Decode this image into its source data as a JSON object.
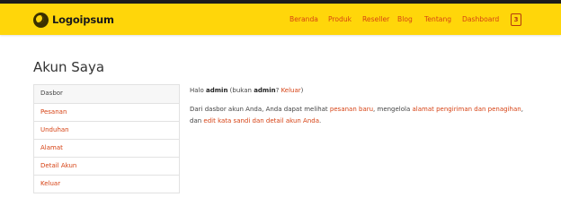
{
  "header": {
    "logo_text": "Logoipsum",
    "nav": [
      "Beranda",
      "Produk",
      "Reseller",
      "Blog",
      "Tentang",
      "Dashboard"
    ],
    "cart_count": "3",
    "colors": {
      "bar": "#ffd60a",
      "link": "#d64214",
      "top_strip": "#1c1c1c"
    }
  },
  "page": {
    "title": "Akun Saya"
  },
  "sidebar": {
    "items": [
      "Dasbor",
      "Pesanan",
      "Unduhan",
      "Alamat",
      "Detail Akun",
      "Keluar"
    ]
  },
  "content": {
    "greeting": {
      "hello": "Halo",
      "user": "admin",
      "not_prefix": "(bukan",
      "user2": "admin",
      "question": "?",
      "logout": "Keluar",
      "close": ")"
    },
    "para": {
      "t1": "Dari dasbor akun Anda, Anda dapat melihat",
      "link1": "pesanan baru",
      "t2": ", mengelola",
      "link2": "alamat pengiriman dan penagihan",
      "t3": ", dan",
      "link3": "edit kata sandi dan detail akun Anda",
      "t4": "."
    }
  }
}
